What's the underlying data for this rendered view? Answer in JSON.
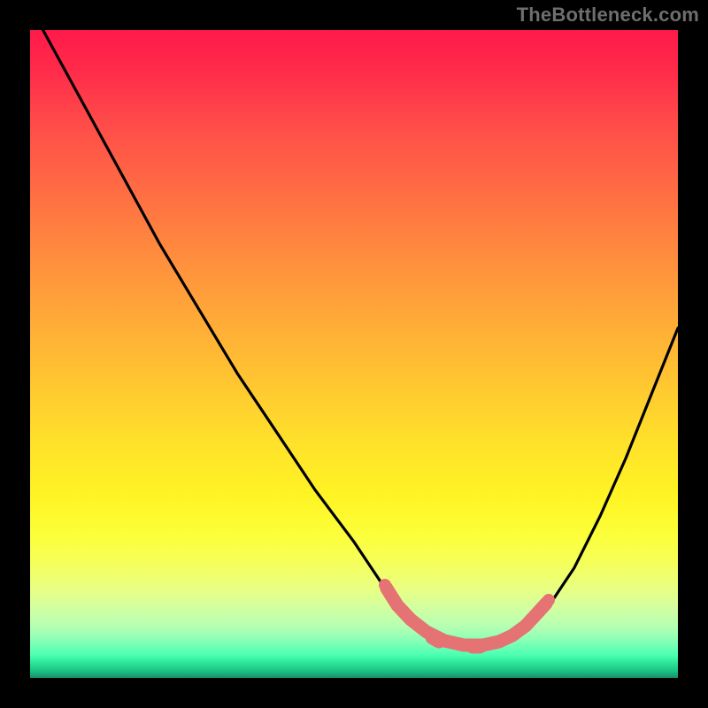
{
  "watermark": "TheBottleneck.com",
  "colors": {
    "frame": "#000000",
    "curve": "#000000",
    "highlight": "#e57373",
    "gradient_top": "#ff1a4a",
    "gradient_bottom": "#1a8b6d"
  },
  "chart_data": {
    "type": "line",
    "title": "",
    "xlabel": "",
    "ylabel": "",
    "xlim": [
      0,
      100
    ],
    "ylim": [
      0,
      100
    ],
    "grid": false,
    "legend": false,
    "series": [
      {
        "name": "bottleneck-curve",
        "x": [
          2,
          8,
          14,
          20,
          26,
          32,
          38,
          44,
          50,
          54,
          57,
          60,
          63,
          66,
          69,
          72,
          74,
          77,
          80,
          84,
          88,
          92,
          96,
          100
        ],
        "y": [
          100,
          89,
          78,
          67,
          57,
          47,
          38,
          29,
          21,
          15,
          11,
          8,
          6,
          5,
          5,
          5,
          6,
          8,
          11,
          17,
          25,
          34,
          44,
          54
        ]
      }
    ],
    "annotations": [
      {
        "name": "valley-highlight",
        "type": "path-marker",
        "description": "thick pink stroke along the valley floor from x≈55 to x≈78 at y≈5–10",
        "color": "#e57373"
      }
    ]
  }
}
